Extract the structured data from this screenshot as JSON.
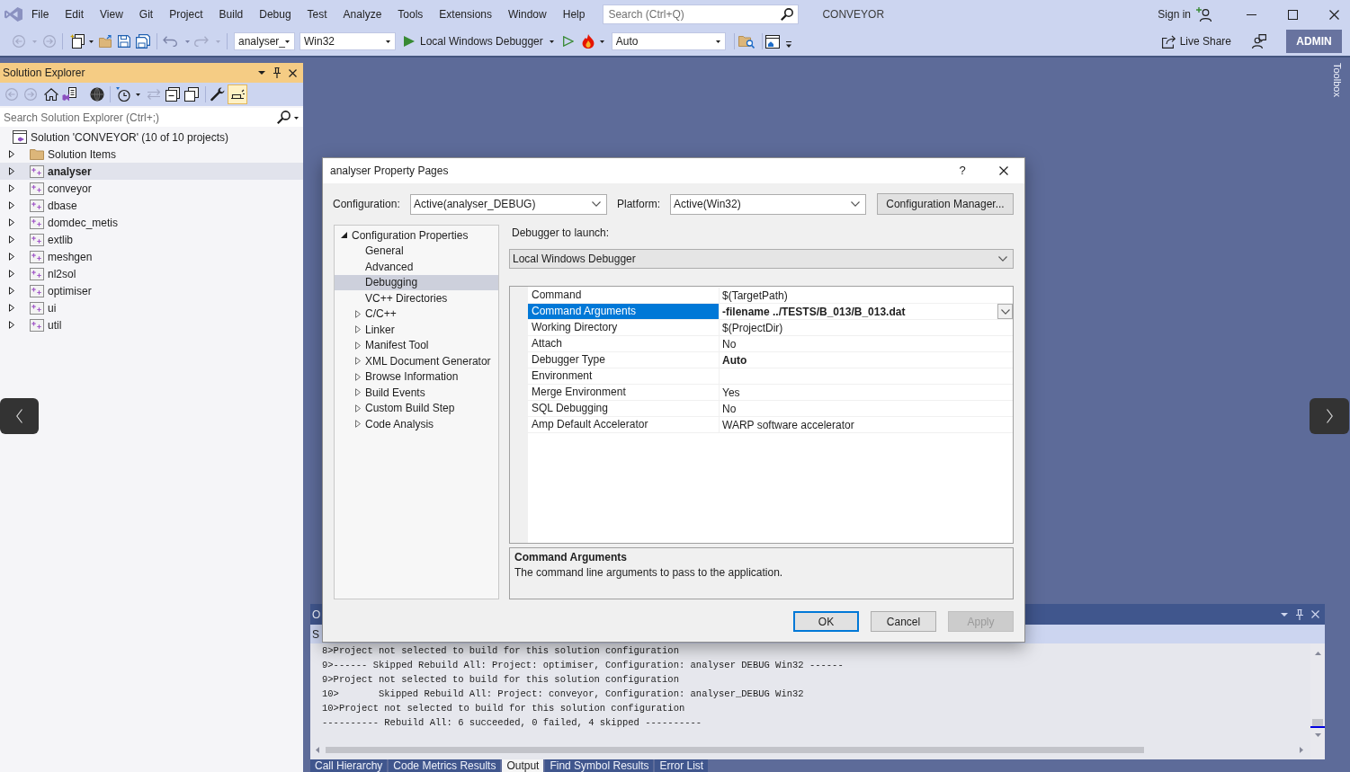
{
  "menu_bar": {
    "items": [
      "File",
      "Edit",
      "View",
      "Git",
      "Project",
      "Build",
      "Debug",
      "Test",
      "Analyze",
      "Tools",
      "Extensions",
      "Window",
      "Help"
    ],
    "search": {
      "placeholder": "Search (Ctrl+Q)"
    },
    "solution_name": "CONVEYOR",
    "sign_in": "Sign in"
  },
  "toolbar": {
    "configuration": "analyser_",
    "platform": "Win32",
    "start_button": "Local Windows Debugger",
    "dropdown_3": "Auto",
    "live_share": "Live Share",
    "account": "ADMIN"
  },
  "solution_explorer": {
    "title": "Solution Explorer",
    "toolbar": {
      "toggle_on": true
    },
    "search": {
      "placeholder": "Search Solution Explorer (Ctrl+;)"
    },
    "solution": {
      "label": "Solution 'CONVEYOR' (10 of 10 projects)",
      "children": [
        {
          "label": "Solution Items",
          "kind": "folder",
          "expanded": false,
          "selected": false,
          "bold": false
        },
        {
          "label": "analyser",
          "kind": "project",
          "expanded": false,
          "selected": true,
          "bold": true
        },
        {
          "label": "conveyor",
          "kind": "project",
          "expanded": false,
          "selected": false,
          "bold": false
        },
        {
          "label": "dbase",
          "kind": "project",
          "expanded": false,
          "selected": false,
          "bold": false
        },
        {
          "label": "domdec_metis",
          "kind": "project",
          "expanded": false,
          "selected": false,
          "bold": false
        },
        {
          "label": "extlib",
          "kind": "project",
          "expanded": false,
          "selected": false,
          "bold": false
        },
        {
          "label": "meshgen",
          "kind": "project",
          "expanded": false,
          "selected": false,
          "bold": false
        },
        {
          "label": "nl2sol",
          "kind": "project",
          "expanded": false,
          "selected": false,
          "bold": false
        },
        {
          "label": "optimiser",
          "kind": "project",
          "expanded": false,
          "selected": false,
          "bold": false
        },
        {
          "label": "ui",
          "kind": "project",
          "expanded": false,
          "selected": false,
          "bold": false
        },
        {
          "label": "util",
          "kind": "project",
          "expanded": false,
          "selected": false,
          "bold": false
        }
      ]
    }
  },
  "toolbox": {
    "label": "Toolbox"
  },
  "dialog": {
    "title": "analyser Property Pages",
    "help": "?",
    "configuration": {
      "label": "Configuration:",
      "value": "Active(analyser_DEBUG)"
    },
    "platform": {
      "label": "Platform:",
      "value": "Active(Win32)"
    },
    "configuration_manager": "Configuration Manager...",
    "tree": {
      "label": "Configuration Properties",
      "expanded": true,
      "children": [
        {
          "label": "General",
          "kind": "page",
          "selected": false
        },
        {
          "label": "Advanced",
          "kind": "page",
          "selected": false
        },
        {
          "label": "Debugging",
          "kind": "page",
          "selected": true
        },
        {
          "label": "VC++ Directories",
          "kind": "page",
          "selected": false
        },
        {
          "label": "C/C++",
          "kind": "group",
          "expanded": false,
          "selected": false
        },
        {
          "label": "Linker",
          "kind": "group",
          "expanded": false,
          "selected": false
        },
        {
          "label": "Manifest Tool",
          "kind": "group",
          "expanded": false,
          "selected": false
        },
        {
          "label": "XML Document Generator",
          "kind": "group",
          "expanded": false,
          "selected": false
        },
        {
          "label": "Browse Information",
          "kind": "group",
          "expanded": false,
          "selected": false
        },
        {
          "label": "Build Events",
          "kind": "group",
          "expanded": false,
          "selected": false
        },
        {
          "label": "Custom Build Step",
          "kind": "group",
          "expanded": false,
          "selected": false
        },
        {
          "label": "Code Analysis",
          "kind": "group",
          "expanded": false,
          "selected": false
        }
      ]
    },
    "debugger": {
      "label": "Debugger to launch:",
      "value": "Local Windows Debugger"
    },
    "properties": [
      {
        "name": "Command",
        "value": "$(TargetPath)",
        "selected": false,
        "bold": false
      },
      {
        "name": "Command Arguments",
        "value": "-filename ../TESTS/B_013/B_013.dat",
        "selected": true,
        "bold": true
      },
      {
        "name": "Working Directory",
        "value": "$(ProjectDir)",
        "selected": false,
        "bold": false
      },
      {
        "name": "Attach",
        "value": "No",
        "selected": false,
        "bold": false
      },
      {
        "name": "Debugger Type",
        "value": "Auto",
        "selected": false,
        "bold": true
      },
      {
        "name": "Environment",
        "selected": false
      },
      {
        "name": "Merge Environment",
        "value": "Yes",
        "selected": false,
        "bold": false
      },
      {
        "name": "SQL Debugging",
        "value": "No",
        "selected": false,
        "bold": false
      },
      {
        "name": "Amp Default Accelerator",
        "value": "WARP software accelerator",
        "selected": false,
        "bold": false
      }
    ],
    "description": {
      "title": "Command Arguments",
      "text": "The command line arguments to pass to the application."
    },
    "buttons": [
      {
        "label": "OK",
        "focused": true,
        "disabled": false
      },
      {
        "label": "Cancel",
        "focused": false,
        "disabled": false
      },
      {
        "label": "Apply",
        "focused": false,
        "disabled": true
      }
    ]
  },
  "output": {
    "title": "O",
    "toolbar_label": "S",
    "lines": [
      "8>Project not selected to build for this solution configuration",
      "9>------ Skipped Rebuild All: Project: optimiser, Configuration: analyser DEBUG Win32 ------",
      "9>Project not selected to build for this solution configuration",
      "10>       Skipped Rebuild All: Project: conveyor, Configuration: analyser_DEBUG Win32",
      "10>Project not selected to build for this solution configuration",
      "---------- Rebuild All: 6 succeeded, 0 failed, 4 skipped ----------"
    ]
  },
  "bottom_tabs": [
    {
      "label": "Call Hierarchy",
      "selected": false
    },
    {
      "label": "Code Metrics Results",
      "selected": false
    },
    {
      "label": "Output",
      "selected": true
    },
    {
      "label": "Find Symbol Results",
      "selected": false
    },
    {
      "label": "Error List",
      "selected": false
    }
  ]
}
